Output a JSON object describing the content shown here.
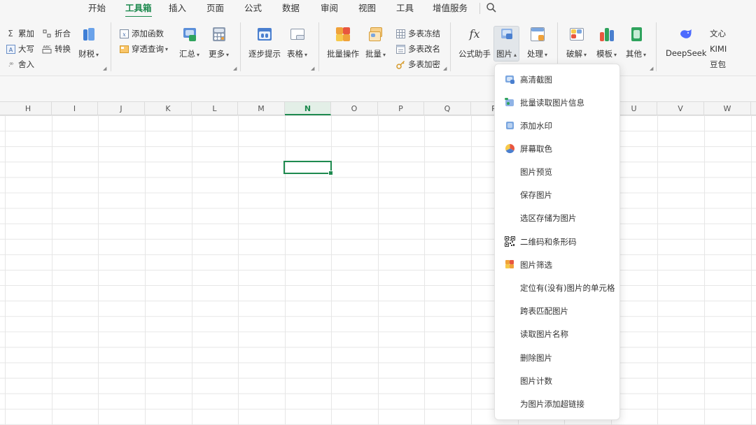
{
  "tabs": [
    "开始",
    "工具箱",
    "插入",
    "页面",
    "公式",
    "数据",
    "审阅",
    "视图",
    "工具",
    "增值服务"
  ],
  "active_tab": "工具箱",
  "ribbon": {
    "g1": {
      "sum": "累加",
      "fold": "折合",
      "upper": "大写",
      "convert": "转换",
      "round": "舍入",
      "tax": "财税"
    },
    "g2": {
      "add_func": "添加函数",
      "cross_query": "穿透查询",
      "summary": "汇总",
      "more": "更多"
    },
    "g3": {
      "step_tips": "逐步提示",
      "table": "表格"
    },
    "g4": {
      "batch_op": "批量操作",
      "batch": "批量",
      "freeze": "多表冻结",
      "rename": "多表改名",
      "encrypt": "多表加密"
    },
    "g5": {
      "formula_helper": "公式助手",
      "image": "图片",
      "process": "处理"
    },
    "g6": {
      "crack": "破解",
      "template": "模板",
      "other": "其他"
    },
    "g7": {
      "deepseek": "DeepSeek",
      "wenxin": "文心",
      "kimi": "KIMI",
      "doubao": "豆包"
    },
    "fx_glyph": "fx",
    "abc_glyph": "ABC"
  },
  "columns": [
    "H",
    "I",
    "J",
    "K",
    "L",
    "M",
    "N",
    "O",
    "P",
    "Q",
    "R",
    "S",
    "T",
    "U",
    "V",
    "W"
  ],
  "active_column": "N",
  "dropdown": [
    {
      "label": "高清截图",
      "icon": "screenshot-icon"
    },
    {
      "label": "批量读取图片信息",
      "icon": "image-info-icon"
    },
    {
      "label": "添加水印",
      "icon": "watermark-icon"
    },
    {
      "label": "屏幕取色",
      "icon": "color-picker-icon"
    },
    {
      "label": "图片预览",
      "icon": ""
    },
    {
      "label": "保存图片",
      "icon": ""
    },
    {
      "label": "选区存储为图片",
      "icon": ""
    },
    {
      "label": "二维码和条形码",
      "icon": "qrcode-icon"
    },
    {
      "label": "图片筛选",
      "icon": "image-filter-icon"
    },
    {
      "label": "定位有(没有)图片的单元格",
      "icon": ""
    },
    {
      "label": "跨表匹配图片",
      "icon": ""
    },
    {
      "label": "读取图片名称",
      "icon": ""
    },
    {
      "label": "删除图片",
      "icon": ""
    },
    {
      "label": "图片计数",
      "icon": ""
    },
    {
      "label": "为图片添加超链接",
      "icon": ""
    }
  ],
  "colors": {
    "accent": "#1e8a4f"
  }
}
